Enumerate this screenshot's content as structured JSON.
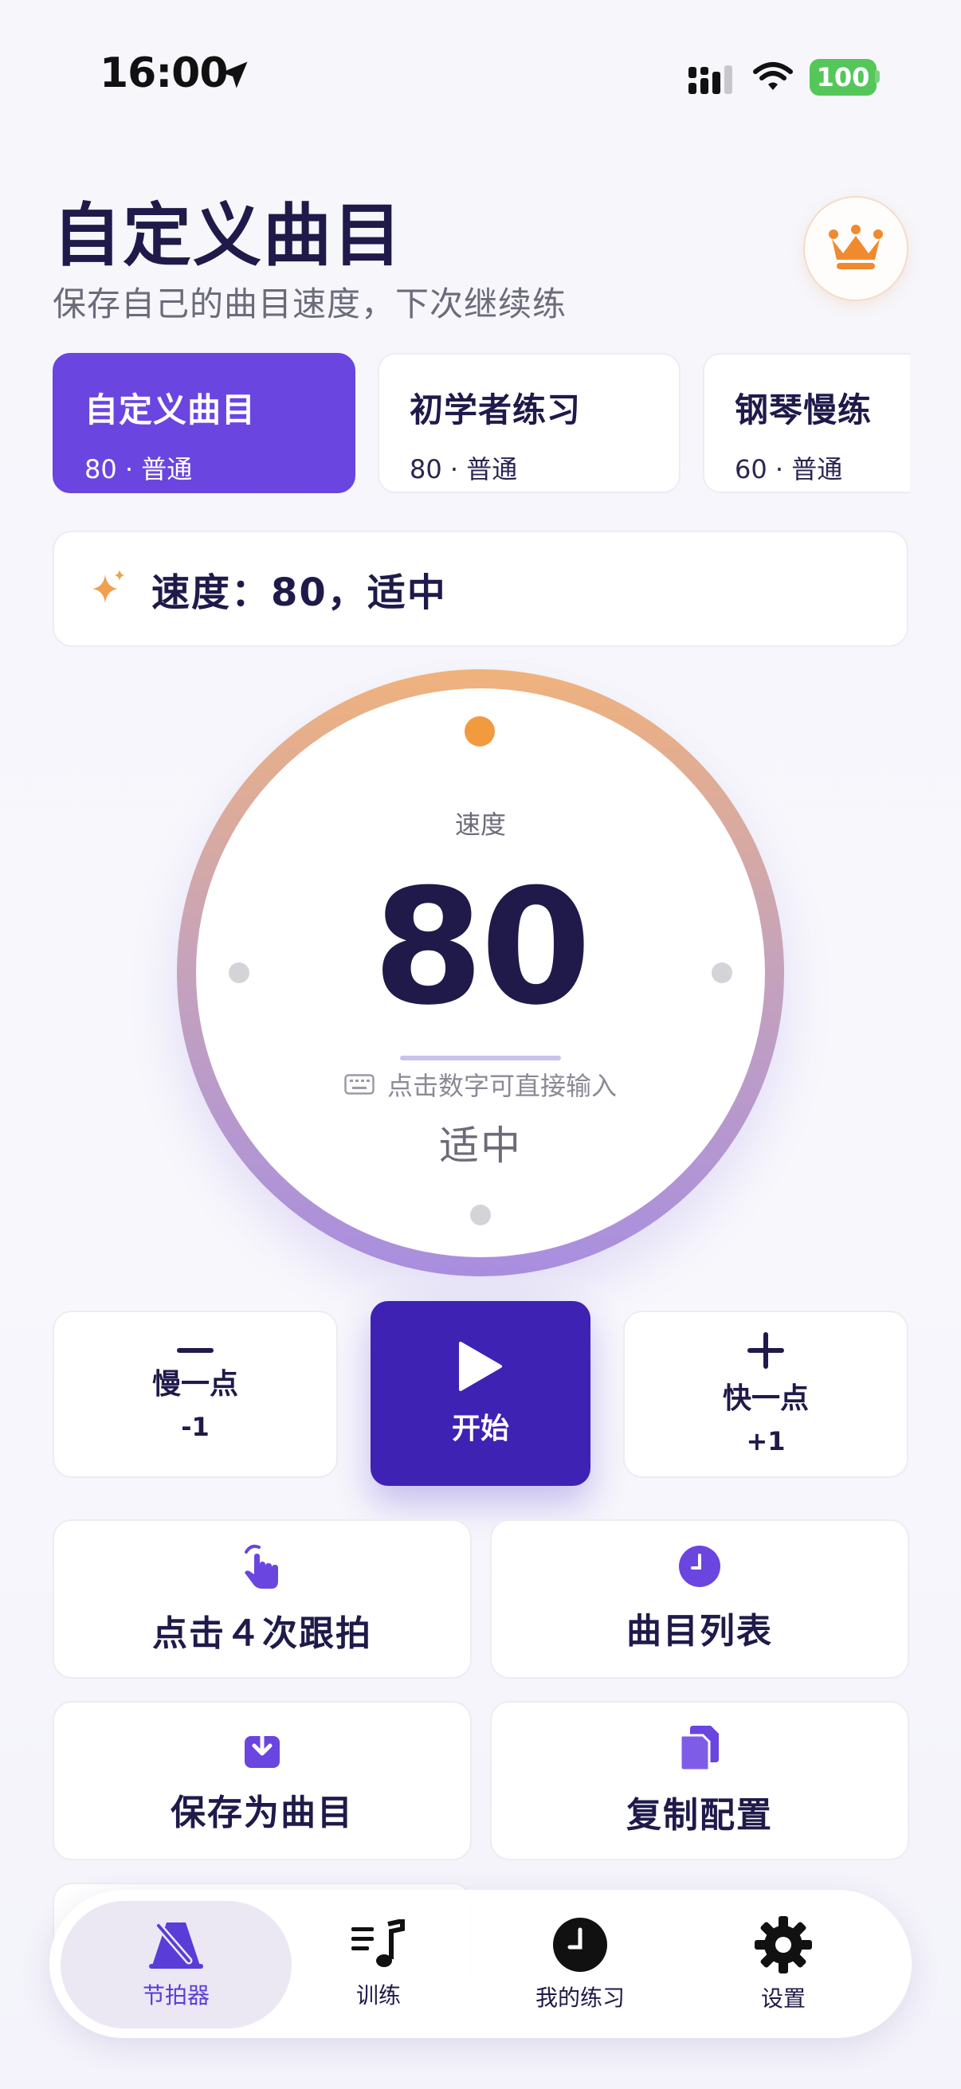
{
  "status_bar": {
    "time": "16:00",
    "battery": "100"
  },
  "header": {
    "title": "自定义曲目",
    "subtitle": "保存自己的曲目速度，下次继续练"
  },
  "presets": [
    {
      "name": "自定义曲目",
      "meta": "80 · 普通",
      "selected": true
    },
    {
      "name": "初学者练习",
      "meta": "80 · 普通",
      "selected": false
    },
    {
      "name": "钢琴慢练",
      "meta": "60 · 普通",
      "selected": false
    }
  ],
  "speed_banner": {
    "text": "速度：80，适中"
  },
  "dial": {
    "label": "速度",
    "value": "80",
    "hint": "点击数字可直接输入",
    "tempo_word": "适中"
  },
  "controls": {
    "slower": {
      "label": "慢一点",
      "sub": "-1"
    },
    "start": {
      "label": "开始"
    },
    "faster": {
      "label": "快一点",
      "sub": "+1"
    }
  },
  "actions": {
    "tap_tempo": "点击４次跟拍",
    "song_list": "曲目列表",
    "save_song": "保存为曲目",
    "copy_config": "复制配置"
  },
  "tabs": [
    {
      "label": "节拍器",
      "icon": "metronome-icon",
      "active": true
    },
    {
      "label": "训练",
      "icon": "music-list-icon",
      "active": false
    },
    {
      "label": "我的练习",
      "icon": "clock-icon",
      "active": false
    },
    {
      "label": "设置",
      "icon": "gear-icon",
      "active": false
    }
  ],
  "colors": {
    "accent": "#6a45e0",
    "start_button": "#3d22b4",
    "crown": "#f08a2e",
    "battery": "#55c75a",
    "text_dark": "#1f1a4a"
  }
}
